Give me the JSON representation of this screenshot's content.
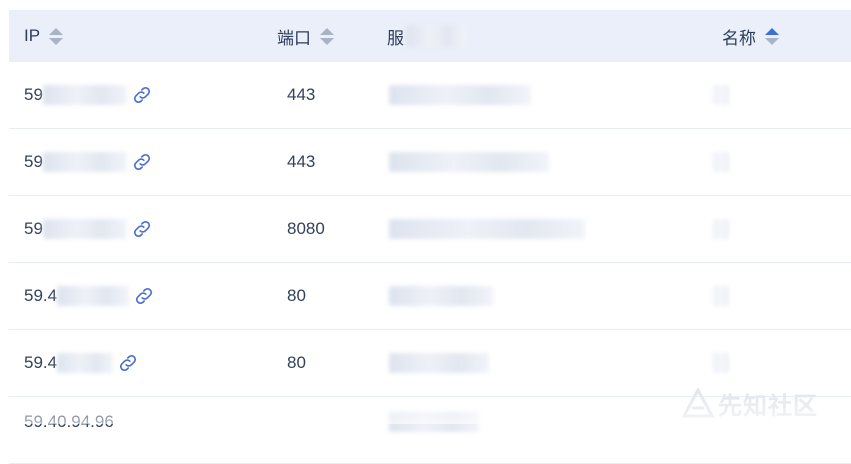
{
  "table": {
    "headers": {
      "ip": "IP",
      "port": "端口",
      "service": "服",
      "name": "名称"
    },
    "rows": [
      {
        "ip": "59",
        "port": "443"
      },
      {
        "ip": "59",
        "port": "443"
      },
      {
        "ip": "59",
        "port": "8080"
      },
      {
        "ip": "59.4",
        "port": "80"
      },
      {
        "ip": "59.4",
        "port": "80"
      },
      {
        "ip": "59.40.94.96",
        "port": ""
      }
    ]
  },
  "watermark": {
    "text": "先知社区"
  },
  "colors": {
    "header_bg": "#eaeff9",
    "accent": "#3d6fd6",
    "icon": "#4a6fd0"
  }
}
